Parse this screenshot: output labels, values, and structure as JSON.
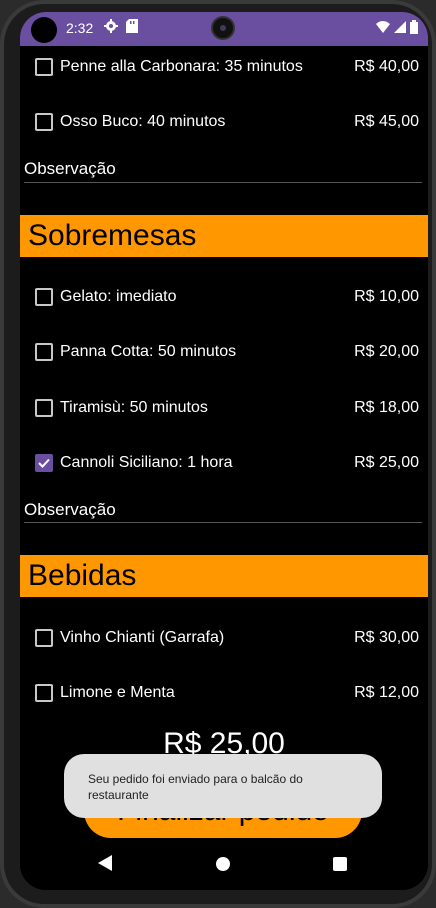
{
  "status_bar": {
    "time": "2:32",
    "icons": [
      "settings-icon",
      "sd-card-icon",
      "wifi-icon",
      "signal-icon",
      "battery-icon"
    ]
  },
  "sections": [
    {
      "items": [
        {
          "label": "Penne alla Carbonara: 35 minutos",
          "price": "R$ 40,00",
          "checked": false
        },
        {
          "label": "Osso Buco: 40 minutos",
          "price": "R$ 45,00",
          "checked": false
        }
      ],
      "observation_label": "Observação"
    },
    {
      "title": "Sobremesas",
      "items": [
        {
          "label": "Gelato: imediato",
          "price": "R$ 10,00",
          "checked": false
        },
        {
          "label": "Panna Cotta: 50 minutos",
          "price": "R$ 20,00",
          "checked": false
        },
        {
          "label": "Tiramisù: 50 minutos",
          "price": "R$ 18,00",
          "checked": false
        },
        {
          "label": "Cannoli Siciliano: 1 hora",
          "price": "R$ 25,00",
          "checked": true
        }
      ],
      "observation_label": "Observação"
    },
    {
      "title": "Bebidas",
      "items": [
        {
          "label": "Vinho Chianti (Garrafa)",
          "price": "R$ 30,00",
          "checked": false
        },
        {
          "label": "Limone e Menta",
          "price": "R$ 12,00",
          "checked": false
        }
      ]
    }
  ],
  "total": "R$ 25,00",
  "finalize_button": "Finalizar pedido",
  "toast": "Seu pedido foi enviado para o balcão do restaurante",
  "colors": {
    "accent": "#6a4fa0",
    "section_header": "#ff9800",
    "background": "#000000"
  }
}
